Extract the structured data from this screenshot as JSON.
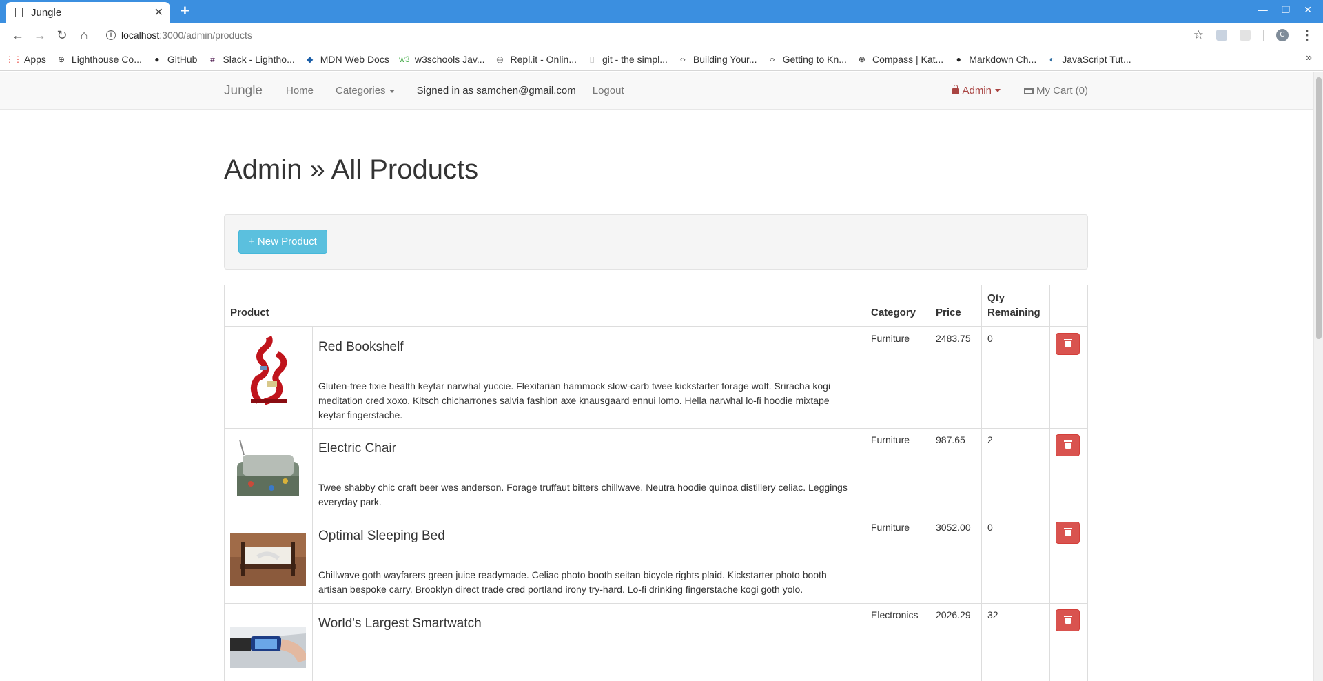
{
  "browser": {
    "tab_title": "Jungle",
    "new_tab": "+",
    "url_host": "localhost",
    "url_path": ":3000/admin/products",
    "profile_initial": "C",
    "bookmarks": [
      {
        "label": "Apps",
        "icon": "apps-grid-icon"
      },
      {
        "label": "Lighthouse Co...",
        "icon": "globe-icon"
      },
      {
        "label": "GitHub",
        "icon": "github-icon"
      },
      {
        "label": "Slack - Lightho...",
        "icon": "slack-icon"
      },
      {
        "label": "MDN Web Docs",
        "icon": "mdn-icon"
      },
      {
        "label": "w3schools Jav...",
        "icon": "w3schools-icon"
      },
      {
        "label": "Repl.it - Onlin...",
        "icon": "replit-icon"
      },
      {
        "label": "git - the simpl...",
        "icon": "document-icon"
      },
      {
        "label": "Building Your...",
        "icon": "code-icon"
      },
      {
        "label": "Getting to Kn...",
        "icon": "code-icon"
      },
      {
        "label": "Compass | Kat...",
        "icon": "globe-icon"
      },
      {
        "label": "Markdown Ch...",
        "icon": "github-icon"
      },
      {
        "label": "JavaScript Tut...",
        "icon": "python-icon"
      }
    ]
  },
  "navbar": {
    "brand": "Jungle",
    "home": "Home",
    "categories": "Categories",
    "signed_in": "Signed in as samchen@gmail.com",
    "logout": "Logout",
    "admin": "Admin",
    "cart": "My Cart (0)"
  },
  "page": {
    "title": "Admin » All Products",
    "new_product_button": "+ New Product"
  },
  "table": {
    "headers": {
      "product": "Product",
      "category": "Category",
      "price": "Price",
      "qty": "Qty Remaining"
    },
    "rows": [
      {
        "name": "Red Bookshelf",
        "description": "Gluten-free fixie health keytar narwhal yuccie. Flexitarian hammock slow-carb twee kickstarter forage wolf. Sriracha kogi meditation cred xoxo. Kitsch chicharrones salvia fashion axe knausgaard ennui lomo. Hella narwhal lo-fi hoodie mixtape keytar fingerstache.",
        "category": "Furniture",
        "price": "2483.75",
        "qty": "0",
        "image": "red-bookshelf-image"
      },
      {
        "name": "Electric Chair",
        "description": "Twee shabby chic craft beer wes anderson. Forage truffaut bitters chillwave. Neutra hoodie quinoa distillery celiac. Leggings everyday park.",
        "category": "Furniture",
        "price": "987.65",
        "qty": "2",
        "image": "electric-chair-image"
      },
      {
        "name": "Optimal Sleeping Bed",
        "description": "Chillwave goth wayfarers green juice readymade. Celiac photo booth seitan bicycle rights plaid. Kickstarter photo booth artisan bespoke carry. Brooklyn direct trade cred portland irony try-hard. Lo-fi drinking fingerstache kogi goth yolo.",
        "category": "Furniture",
        "price": "3052.00",
        "qty": "0",
        "image": "sleeping-bed-image"
      },
      {
        "name": "World's Largest Smartwatch",
        "description": "",
        "category": "Electronics",
        "price": "2026.29",
        "qty": "32",
        "image": "smartwatch-image"
      }
    ]
  }
}
